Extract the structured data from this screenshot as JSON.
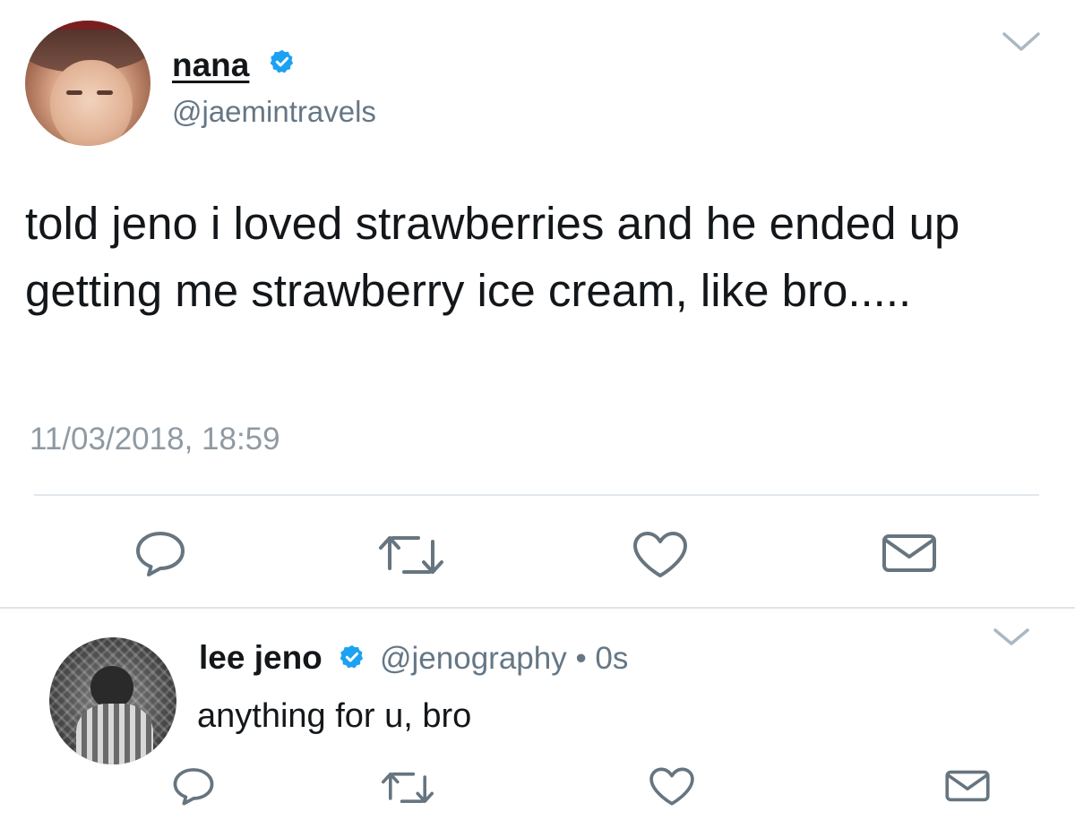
{
  "main_tweet": {
    "author": {
      "name": "nana",
      "handle": "@jaemintravels",
      "verified": true
    },
    "text": "told jeno i loved strawberries and he ended up getting me strawberry ice cream, like bro.....",
    "timestamp": "11/03/2018, 18:59",
    "actions": [
      {
        "name": "reply",
        "icon": "reply-icon"
      },
      {
        "name": "retweet",
        "icon": "retweet-icon"
      },
      {
        "name": "like",
        "icon": "heart-icon"
      },
      {
        "name": "direct-message",
        "icon": "envelope-icon"
      }
    ]
  },
  "reply_tweet": {
    "author": {
      "name": "lee jeno",
      "handle": "@jenography",
      "verified": true
    },
    "meta": "@jenography • 0s",
    "text": "anything for u, bro",
    "actions": [
      {
        "name": "reply",
        "icon": "reply-icon"
      },
      {
        "name": "retweet",
        "icon": "retweet-icon"
      },
      {
        "name": "like",
        "icon": "heart-icon"
      },
      {
        "name": "direct-message",
        "icon": "envelope-icon"
      }
    ]
  },
  "colors": {
    "text_primary": "#14171a",
    "text_secondary": "#657786",
    "timestamp": "#8f9aa3",
    "verified_blue": "#1da1f2",
    "icon": "#66757f",
    "divider": "#e1e8ed"
  }
}
